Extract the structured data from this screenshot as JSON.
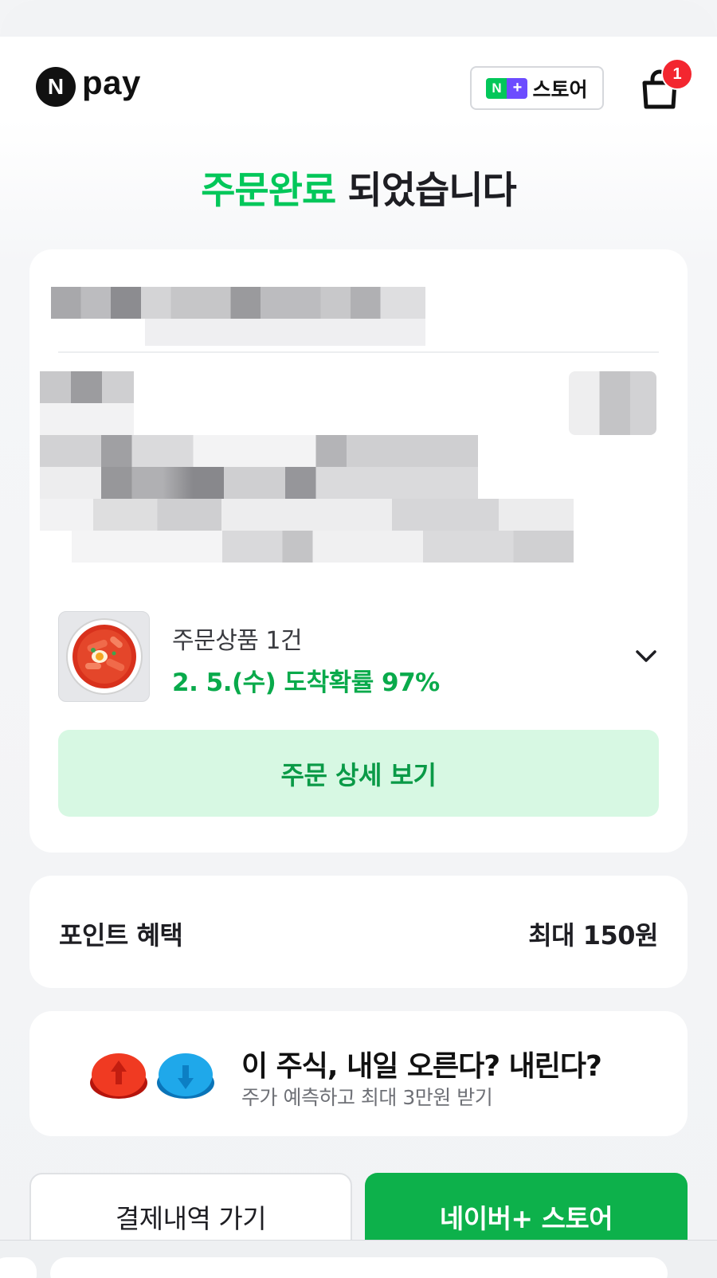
{
  "header": {
    "logo_letter": "N",
    "logo_text": "pay",
    "store_chip": {
      "mark_n": "N",
      "mark_plus": "+",
      "label": "스토어"
    },
    "cart_badge": "1"
  },
  "headline": {
    "highlight": "주문완료",
    "rest": " 되었습니다"
  },
  "order": {
    "product_count": "주문상품 1건",
    "arrival": "2. 5.(수) 도착확률 97%",
    "detail_button": "주문 상세 보기"
  },
  "points": {
    "label": "포인트 혜택",
    "value": "최대 150원"
  },
  "promo": {
    "title": "이 주식, 내일 오른다? 내린다?",
    "subtitle": "주가 예측하고 최대 3만원 받기"
  },
  "actions": {
    "history": "결제내역 가기",
    "store": "네이버+ 스토어"
  },
  "colors": {
    "brand_green": "#03c75a",
    "arrival_green": "#09aa4b",
    "detail_bg": "#d7f8e3",
    "store_button": "#0db14b",
    "badge_red": "#f3262f",
    "plus_purple": "#6c4cff"
  }
}
